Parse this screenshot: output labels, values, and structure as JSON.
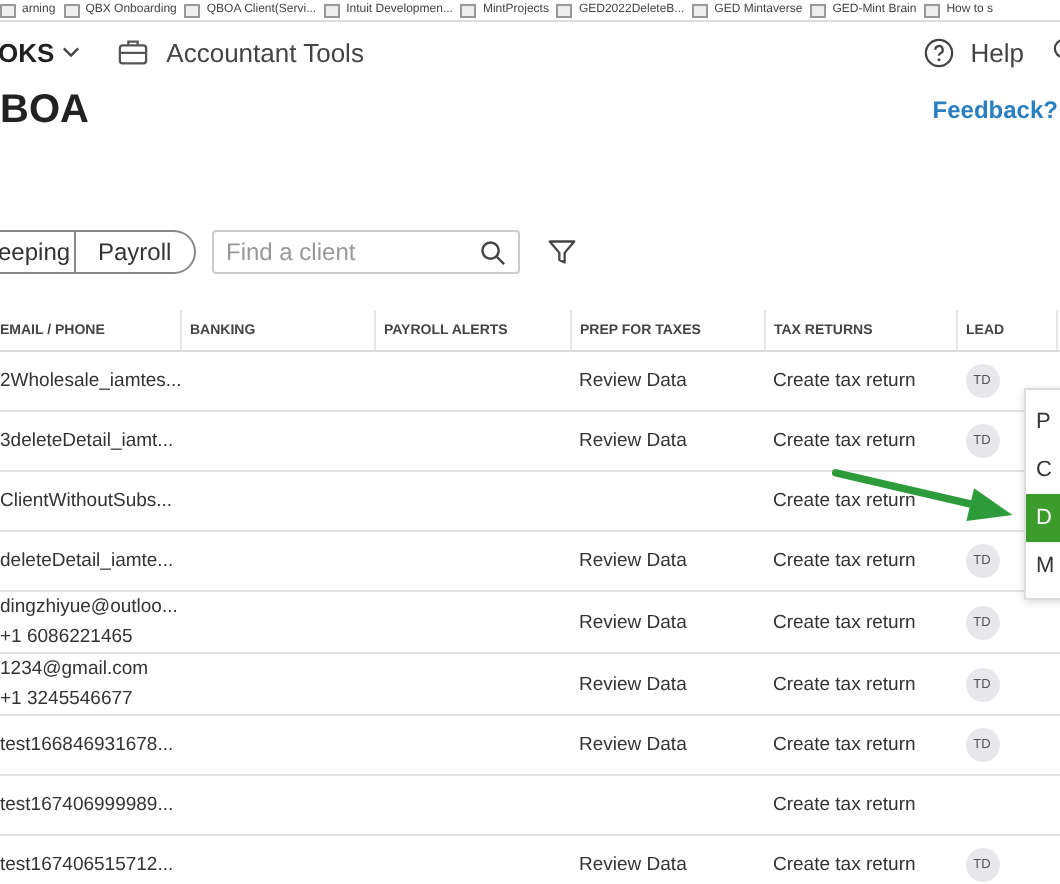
{
  "bookmarks": [
    "arning",
    "QBX Onboarding",
    "QBOA Client(Servi...",
    "Intuit Developmen...",
    "MintProjects",
    "GED2022DeleteB...",
    "GED Mintaverse",
    "GED-Mint Brain",
    "How to s"
  ],
  "nav": {
    "brand": "OKS",
    "tools": "Accountant Tools",
    "help": "Help"
  },
  "page_title": "BOA",
  "feedback": "Feedback?",
  "segments": [
    {
      "label": "eeping",
      "selected": false
    },
    {
      "label": "Payroll",
      "selected": false
    }
  ],
  "search": {
    "placeholder": "Find a client"
  },
  "table": {
    "columns": [
      "EMAIL / PHONE",
      "BANKING",
      "PAYROLL ALERTS",
      "PREP FOR TAXES",
      "TAX RETURNS",
      "LEAD"
    ],
    "rows": [
      {
        "email": "2Wholesale_iamtes...",
        "prep": "Review Data",
        "tax": "Create tax return",
        "lead": "TD"
      },
      {
        "email": "3deleteDetail_iamt...",
        "prep": "Review Data",
        "tax": "Create tax return",
        "lead": "TD"
      },
      {
        "email": "ClientWithoutSubs...",
        "tax": "Create tax return"
      },
      {
        "email": "deleteDetail_iamte...",
        "prep": "Review Data",
        "tax": "Create tax return",
        "lead": "TD"
      },
      {
        "email": "dingzhiyue@outloo...",
        "phone": "+1 6086221465",
        "prep": "Review Data",
        "tax": "Create tax return",
        "lead": "TD"
      },
      {
        "email": "1234@gmail.com",
        "phone": "+1 3245546677",
        "prep": "Review Data",
        "tax": "Create tax return",
        "lead": "TD"
      },
      {
        "email": "test166846931678...",
        "prep": "Review Data",
        "tax": "Create tax return",
        "lead": "TD"
      },
      {
        "email": "test167406999989...",
        "tax": "Create tax return"
      },
      {
        "email": "test167406515712...",
        "prep": "Review Data",
        "tax": "Create tax return",
        "lead": "TD"
      }
    ]
  },
  "menu": [
    {
      "label": "P",
      "selected": false
    },
    {
      "label": "C",
      "selected": false
    },
    {
      "label": "D",
      "selected": true
    },
    {
      "label": "M",
      "selected": false
    }
  ]
}
